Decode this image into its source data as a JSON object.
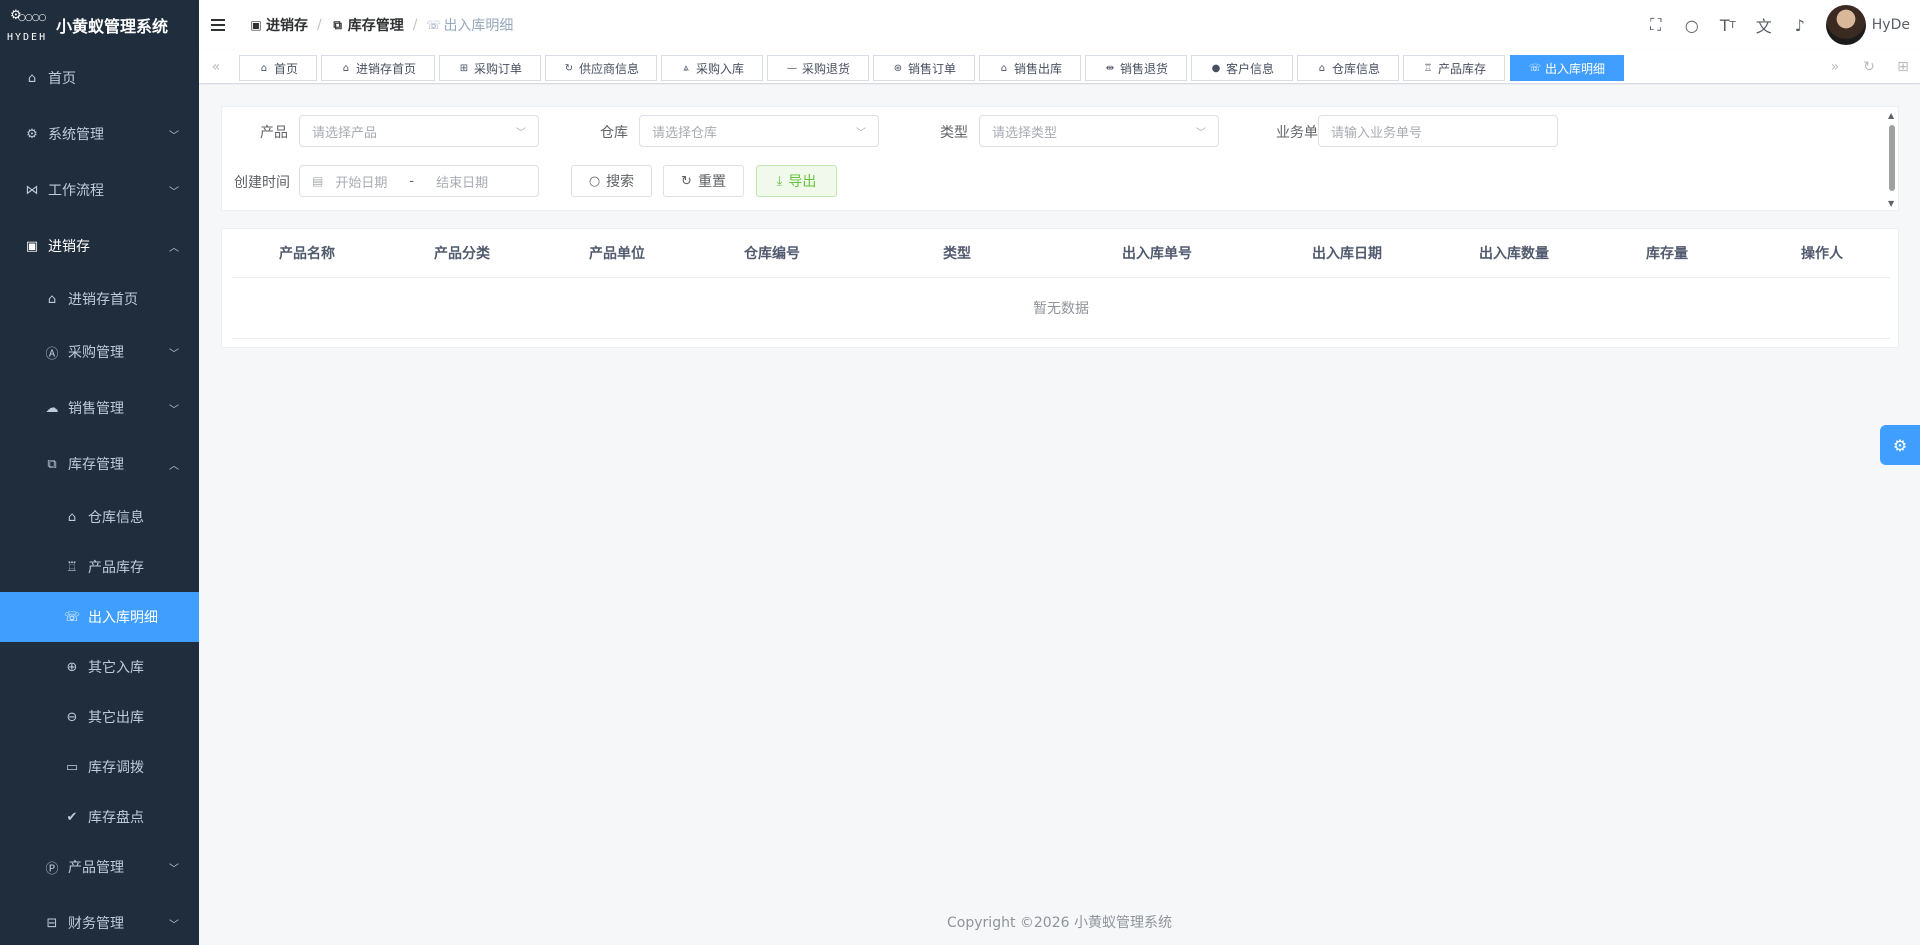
{
  "app": {
    "title": "小黄蚁管理系统",
    "logo_word": "HYDEH"
  },
  "sidebar": {
    "items": [
      {
        "label": "首页",
        "icon": "home-icon"
      },
      {
        "label": "系统管理",
        "icon": "gear-icon"
      },
      {
        "label": "工作流程",
        "icon": "workflow-icon"
      },
      {
        "label": "进销存",
        "icon": "inventory-icon"
      },
      {
        "label": "进销存首页",
        "icon": "home-icon"
      },
      {
        "label": "采购管理",
        "icon": "purchase-icon"
      },
      {
        "label": "销售管理",
        "icon": "cloud-icon"
      },
      {
        "label": "库存管理",
        "icon": "stock-icon"
      },
      {
        "label": "仓库信息",
        "icon": "warehouse-icon"
      },
      {
        "label": "产品库存",
        "icon": "cup-icon"
      },
      {
        "label": "出入库明细",
        "icon": "stock-detail-icon"
      },
      {
        "label": "其它入库",
        "icon": "zoom-in-icon"
      },
      {
        "label": "其它出库",
        "icon": "zoom-out-icon"
      },
      {
        "label": "库存调拨",
        "icon": "folder-icon"
      },
      {
        "label": "库存盘点",
        "icon": "check-circle-icon"
      },
      {
        "label": "产品管理",
        "icon": "product-icon"
      },
      {
        "label": "财务管理",
        "icon": "finance-icon"
      }
    ]
  },
  "breadcrumb": [
    {
      "label": "进销存"
    },
    {
      "label": "库存管理"
    },
    {
      "label": "出入库明细"
    }
  ],
  "navbar": {
    "user_name": "HyDe"
  },
  "tags": [
    {
      "label": "首页"
    },
    {
      "label": "进销存首页"
    },
    {
      "label": "采购订单"
    },
    {
      "label": "供应商信息"
    },
    {
      "label": "采购入库"
    },
    {
      "label": "采购退货"
    },
    {
      "label": "销售订单"
    },
    {
      "label": "销售出库"
    },
    {
      "label": "销售退货"
    },
    {
      "label": "客户信息"
    },
    {
      "label": "仓库信息"
    },
    {
      "label": "产品库存"
    },
    {
      "label": "出入库明细"
    }
  ],
  "search": {
    "product_label": "产品",
    "product_placeholder": "请选择产品",
    "warehouse_label": "仓库",
    "warehouse_placeholder": "请选择仓库",
    "type_label": "类型",
    "type_placeholder": "请选择类型",
    "bizno_label": "业务单号",
    "bizno_placeholder": "请输入业务单号",
    "created_label": "创建时间",
    "start_placeholder": "开始日期",
    "range_sep": "-",
    "end_placeholder": "结束日期",
    "search_btn": "搜索",
    "reset_btn": "重置",
    "export_btn": "导出"
  },
  "table": {
    "columns": [
      "产品名称",
      "产品分类",
      "产品单位",
      "仓库编号",
      "类型",
      "出入库单号",
      "出入库日期",
      "出入库数量",
      "库存量",
      "操作人"
    ],
    "empty_text": "暂无数据"
  },
  "footer": {
    "copyright": "Copyright ©2026 小黄蚁管理系统"
  },
  "colors": {
    "sidebar_bg": "#1f2d3d",
    "accent": "#409eff",
    "export_green": "#67c23a"
  }
}
